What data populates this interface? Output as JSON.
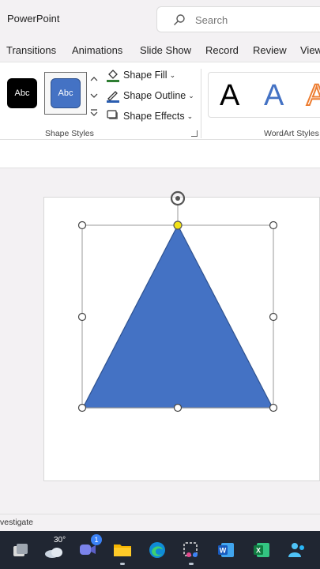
{
  "app": {
    "title": "PowerPoint"
  },
  "search": {
    "placeholder": "Search"
  },
  "tabs": [
    "Transitions",
    "Animations",
    "Slide Show",
    "Record",
    "Review",
    "View"
  ],
  "ribbon": {
    "shape_styles": {
      "swatches": [
        "Abc",
        "Abc"
      ],
      "commands": {
        "fill": "Shape Fill",
        "outline": "Shape Outline",
        "effects": "Shape Effects"
      },
      "label": "Shape Styles"
    },
    "wordart": {
      "samples": [
        "A",
        "A",
        "A"
      ],
      "label": "WordArt Styles"
    }
  },
  "slide": {
    "shape": "isosceles-triangle",
    "fill_color": "#4472c4",
    "outline_color": "#2f528f"
  },
  "status": {
    "text": "vestigate"
  },
  "taskbar": {
    "weather_temp": "30°",
    "chat_badge": "1",
    "apps": [
      "task-view",
      "weather",
      "teams-chat",
      "file-explorer",
      "edge",
      "snipping-tool",
      "word",
      "excel",
      "teams"
    ]
  }
}
